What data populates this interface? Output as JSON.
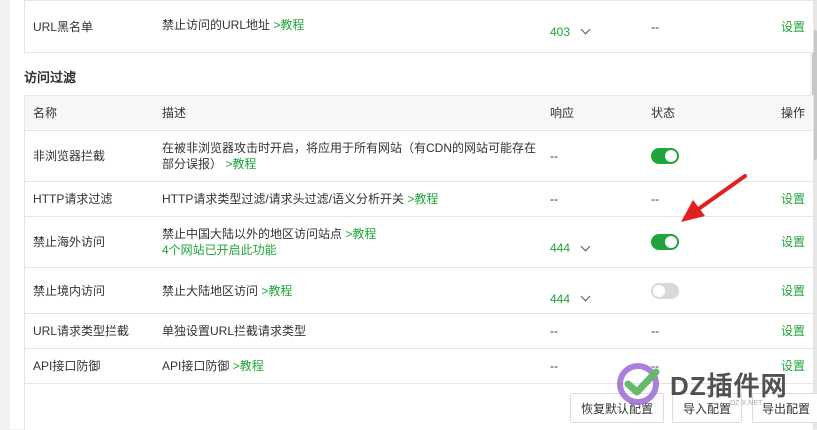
{
  "top_row": {
    "name": "URL黑名单",
    "desc": "禁止访问的URL地址",
    "link": ">教程",
    "response": "403",
    "status": "--",
    "op": "设置"
  },
  "section": {
    "title": "访问过滤"
  },
  "columns": {
    "name": "名称",
    "desc": "描述",
    "response": "响应",
    "status": "状态",
    "op": "操作"
  },
  "rows": [
    {
      "name": "非浏览器拦截",
      "desc": "在被非浏览器攻击时开启，将应用于所有网站（有CDN的网站可能存在部分误报）",
      "link": ">教程",
      "response": "--",
      "status": "on",
      "op": ""
    },
    {
      "name": "HTTP请求过滤",
      "desc": "HTTP请求类型过滤/请求头过滤/语义分析开关",
      "link": ">教程",
      "response": "--",
      "status": "--",
      "op": "设置"
    },
    {
      "name": "禁止海外访问",
      "desc": "禁止中国大陆以外的地区访问站点",
      "link": ">教程",
      "extra": "4个网站已开启此功能",
      "response": "444",
      "status": "on",
      "op": "设置"
    },
    {
      "name": "禁止境内访问",
      "desc": "禁止大陆地区访问",
      "link": ">教程",
      "response": "444",
      "status": "off",
      "op": "设置"
    },
    {
      "name": "URL请求类型拦截",
      "desc": "单独设置URL拦截请求类型",
      "link": "",
      "response": "--",
      "status": "--",
      "op": "设置"
    },
    {
      "name": "API接口防御",
      "desc": "API接口防御",
      "link": ">教程",
      "response": "--",
      "status": "--",
      "op": "设置"
    }
  ],
  "buttons": {
    "restore": "恢复默认配置",
    "import": "导入配置",
    "export": "导出配置"
  },
  "watermark": {
    "text": "DZ插件网",
    "sub": "DZ-X.NET"
  },
  "colors": {
    "accent": "#20a53a",
    "arrow": "#e02020"
  }
}
